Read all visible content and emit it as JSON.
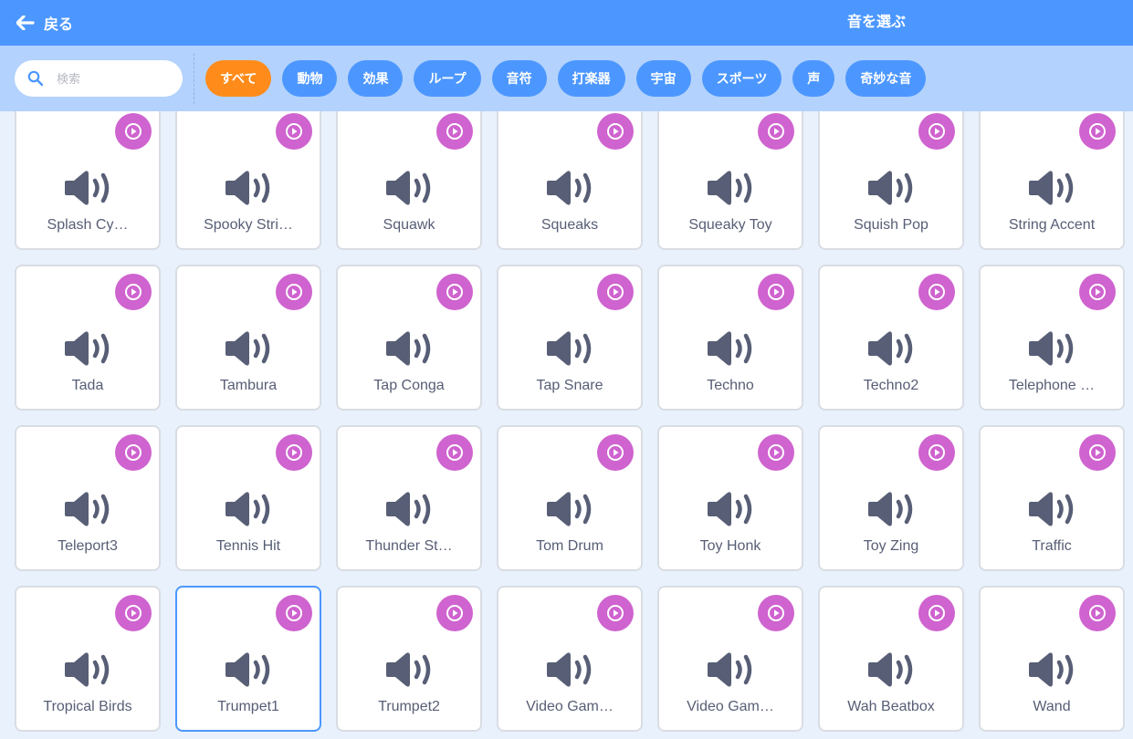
{
  "header": {
    "back_label": "戻る",
    "title": "音を選ぶ"
  },
  "search": {
    "placeholder": "検索",
    "value": ""
  },
  "tags": [
    "すべて",
    "動物",
    "効果",
    "ループ",
    "音符",
    "打楽器",
    "宇宙",
    "スポーツ",
    "声",
    "奇妙な音"
  ],
  "active_tag": "すべて",
  "sounds": [
    "Splash Cy…",
    "Spooky Stri…",
    "Squawk",
    "Squeaks",
    "Squeaky Toy",
    "Squish Pop",
    "String Accent",
    "Tada",
    "Tambura",
    "Tap Conga",
    "Tap Snare",
    "Techno",
    "Techno2",
    "Telephone …",
    "Teleport3",
    "Tennis Hit",
    "Thunder St…",
    "Tom Drum",
    "Toy Honk",
    "Toy Zing",
    "Traffic",
    "Tropical Birds",
    "Trumpet1",
    "Trumpet2",
    "Video Gam…",
    "Video Gam…",
    "Wah Beatbox",
    "Wand"
  ],
  "selected_sound": "Trumpet1",
  "colors": {
    "header": "#4c97ff",
    "filter_bar": "#b3d2fd",
    "tag": "#4c97ff",
    "active_tag": "#ff8c1a",
    "play_button": "#cf63cf",
    "speaker_icon": "#575e75",
    "selected_border": "#4c97ff"
  }
}
